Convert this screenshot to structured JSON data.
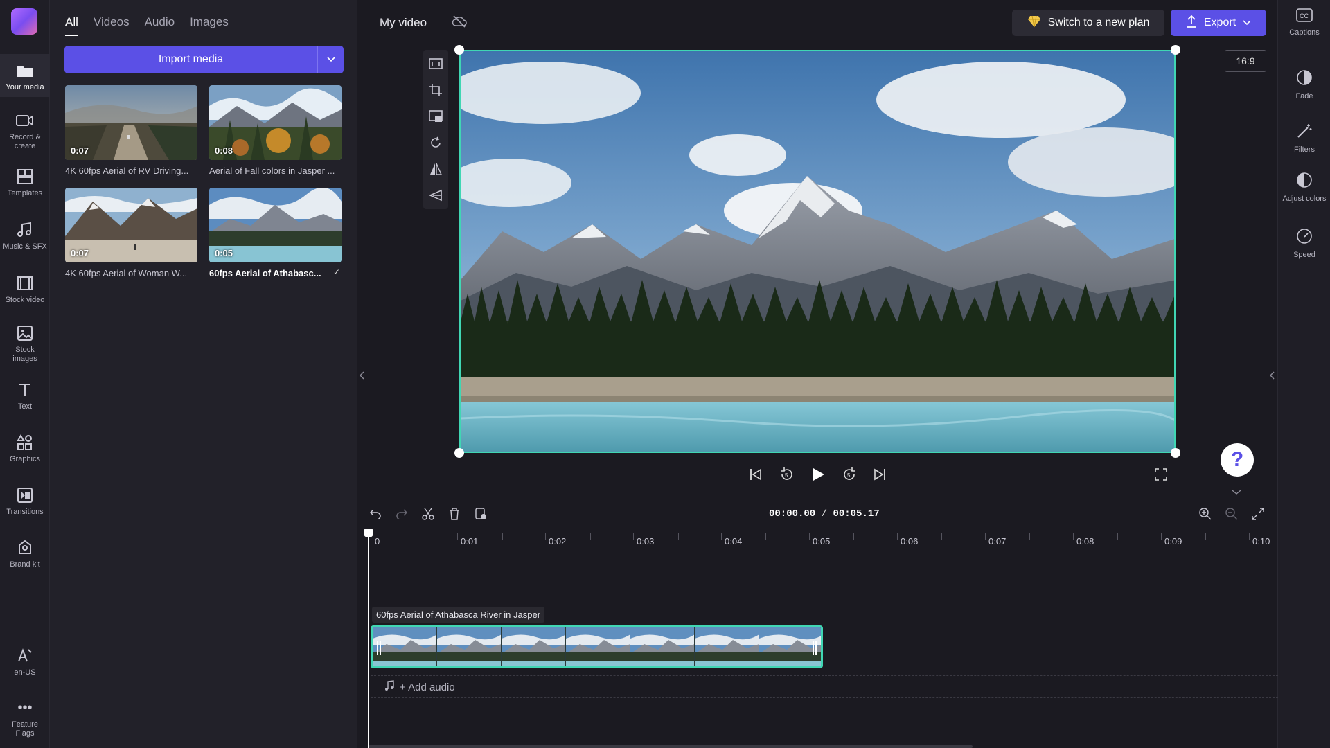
{
  "rail": {
    "items": [
      {
        "label": "Your media"
      },
      {
        "label": "Record & create"
      },
      {
        "label": "Templates"
      },
      {
        "label": "Music & SFX"
      },
      {
        "label": "Stock video"
      },
      {
        "label": "Stock images"
      },
      {
        "label": "Text"
      },
      {
        "label": "Graphics"
      },
      {
        "label": "Transitions"
      },
      {
        "label": "Brand kit"
      },
      {
        "label": "en-US"
      },
      {
        "label": "Feature Flags"
      }
    ]
  },
  "media": {
    "tabs": [
      "All",
      "Videos",
      "Audio",
      "Images"
    ],
    "active_tab": "All",
    "import_label": "Import media",
    "items": [
      {
        "duration": "0:07",
        "title": "4K 60fps Aerial of RV Driving..."
      },
      {
        "duration": "0:08",
        "title": "Aerial of Fall colors in Jasper ..."
      },
      {
        "duration": "0:07",
        "title": "4K 60fps Aerial of Woman W..."
      },
      {
        "duration": "0:05",
        "title": "60fps Aerial of Athabasc...",
        "added_check": "✓"
      }
    ]
  },
  "header": {
    "project_title": "My video",
    "plan_button": "Switch to a new plan",
    "export_button": "Export"
  },
  "preview": {
    "aspect_ratio": "16:9"
  },
  "right_rail": {
    "items": [
      {
        "label": "Captions"
      },
      {
        "label": "Fade"
      },
      {
        "label": "Filters"
      },
      {
        "label": "Adjust colors"
      },
      {
        "label": "Speed"
      }
    ]
  },
  "timeline": {
    "current_time": "00:00.00",
    "separator": "/",
    "total_time": "00:05.17",
    "ticks": [
      "0",
      "0:01",
      "0:02",
      "0:03",
      "0:04",
      "0:05",
      "0:06",
      "0:07",
      "0:08",
      "0:09",
      "0:10"
    ],
    "clip_label": "60fps Aerial of Athabasca River in Jasper",
    "add_audio_label": "+ Add audio"
  },
  "colors": {
    "accent": "#5b50e6",
    "selection": "#40d6b3",
    "background": "#1b1a21"
  }
}
